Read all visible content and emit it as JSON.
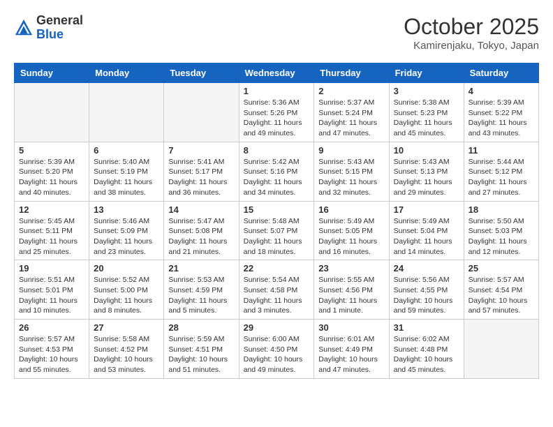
{
  "header": {
    "logo_general": "General",
    "logo_blue": "Blue",
    "month_title": "October 2025",
    "location": "Kamirenjaku, Tokyo, Japan"
  },
  "days_of_week": [
    "Sunday",
    "Monday",
    "Tuesday",
    "Wednesday",
    "Thursday",
    "Friday",
    "Saturday"
  ],
  "weeks": [
    [
      {
        "day": "",
        "info": ""
      },
      {
        "day": "",
        "info": ""
      },
      {
        "day": "",
        "info": ""
      },
      {
        "day": "1",
        "info": "Sunrise: 5:36 AM\nSunset: 5:26 PM\nDaylight: 11 hours and 49 minutes."
      },
      {
        "day": "2",
        "info": "Sunrise: 5:37 AM\nSunset: 5:24 PM\nDaylight: 11 hours and 47 minutes."
      },
      {
        "day": "3",
        "info": "Sunrise: 5:38 AM\nSunset: 5:23 PM\nDaylight: 11 hours and 45 minutes."
      },
      {
        "day": "4",
        "info": "Sunrise: 5:39 AM\nSunset: 5:22 PM\nDaylight: 11 hours and 43 minutes."
      }
    ],
    [
      {
        "day": "5",
        "info": "Sunrise: 5:39 AM\nSunset: 5:20 PM\nDaylight: 11 hours and 40 minutes."
      },
      {
        "day": "6",
        "info": "Sunrise: 5:40 AM\nSunset: 5:19 PM\nDaylight: 11 hours and 38 minutes."
      },
      {
        "day": "7",
        "info": "Sunrise: 5:41 AM\nSunset: 5:17 PM\nDaylight: 11 hours and 36 minutes."
      },
      {
        "day": "8",
        "info": "Sunrise: 5:42 AM\nSunset: 5:16 PM\nDaylight: 11 hours and 34 minutes."
      },
      {
        "day": "9",
        "info": "Sunrise: 5:43 AM\nSunset: 5:15 PM\nDaylight: 11 hours and 32 minutes."
      },
      {
        "day": "10",
        "info": "Sunrise: 5:43 AM\nSunset: 5:13 PM\nDaylight: 11 hours and 29 minutes."
      },
      {
        "day": "11",
        "info": "Sunrise: 5:44 AM\nSunset: 5:12 PM\nDaylight: 11 hours and 27 minutes."
      }
    ],
    [
      {
        "day": "12",
        "info": "Sunrise: 5:45 AM\nSunset: 5:11 PM\nDaylight: 11 hours and 25 minutes."
      },
      {
        "day": "13",
        "info": "Sunrise: 5:46 AM\nSunset: 5:09 PM\nDaylight: 11 hours and 23 minutes."
      },
      {
        "day": "14",
        "info": "Sunrise: 5:47 AM\nSunset: 5:08 PM\nDaylight: 11 hours and 21 minutes."
      },
      {
        "day": "15",
        "info": "Sunrise: 5:48 AM\nSunset: 5:07 PM\nDaylight: 11 hours and 18 minutes."
      },
      {
        "day": "16",
        "info": "Sunrise: 5:49 AM\nSunset: 5:05 PM\nDaylight: 11 hours and 16 minutes."
      },
      {
        "day": "17",
        "info": "Sunrise: 5:49 AM\nSunset: 5:04 PM\nDaylight: 11 hours and 14 minutes."
      },
      {
        "day": "18",
        "info": "Sunrise: 5:50 AM\nSunset: 5:03 PM\nDaylight: 11 hours and 12 minutes."
      }
    ],
    [
      {
        "day": "19",
        "info": "Sunrise: 5:51 AM\nSunset: 5:01 PM\nDaylight: 11 hours and 10 minutes."
      },
      {
        "day": "20",
        "info": "Sunrise: 5:52 AM\nSunset: 5:00 PM\nDaylight: 11 hours and 8 minutes."
      },
      {
        "day": "21",
        "info": "Sunrise: 5:53 AM\nSunset: 4:59 PM\nDaylight: 11 hours and 5 minutes."
      },
      {
        "day": "22",
        "info": "Sunrise: 5:54 AM\nSunset: 4:58 PM\nDaylight: 11 hours and 3 minutes."
      },
      {
        "day": "23",
        "info": "Sunrise: 5:55 AM\nSunset: 4:56 PM\nDaylight: 11 hours and 1 minute."
      },
      {
        "day": "24",
        "info": "Sunrise: 5:56 AM\nSunset: 4:55 PM\nDaylight: 10 hours and 59 minutes."
      },
      {
        "day": "25",
        "info": "Sunrise: 5:57 AM\nSunset: 4:54 PM\nDaylight: 10 hours and 57 minutes."
      }
    ],
    [
      {
        "day": "26",
        "info": "Sunrise: 5:57 AM\nSunset: 4:53 PM\nDaylight: 10 hours and 55 minutes."
      },
      {
        "day": "27",
        "info": "Sunrise: 5:58 AM\nSunset: 4:52 PM\nDaylight: 10 hours and 53 minutes."
      },
      {
        "day": "28",
        "info": "Sunrise: 5:59 AM\nSunset: 4:51 PM\nDaylight: 10 hours and 51 minutes."
      },
      {
        "day": "29",
        "info": "Sunrise: 6:00 AM\nSunset: 4:50 PM\nDaylight: 10 hours and 49 minutes."
      },
      {
        "day": "30",
        "info": "Sunrise: 6:01 AM\nSunset: 4:49 PM\nDaylight: 10 hours and 47 minutes."
      },
      {
        "day": "31",
        "info": "Sunrise: 6:02 AM\nSunset: 4:48 PM\nDaylight: 10 hours and 45 minutes."
      },
      {
        "day": "",
        "info": ""
      }
    ]
  ]
}
